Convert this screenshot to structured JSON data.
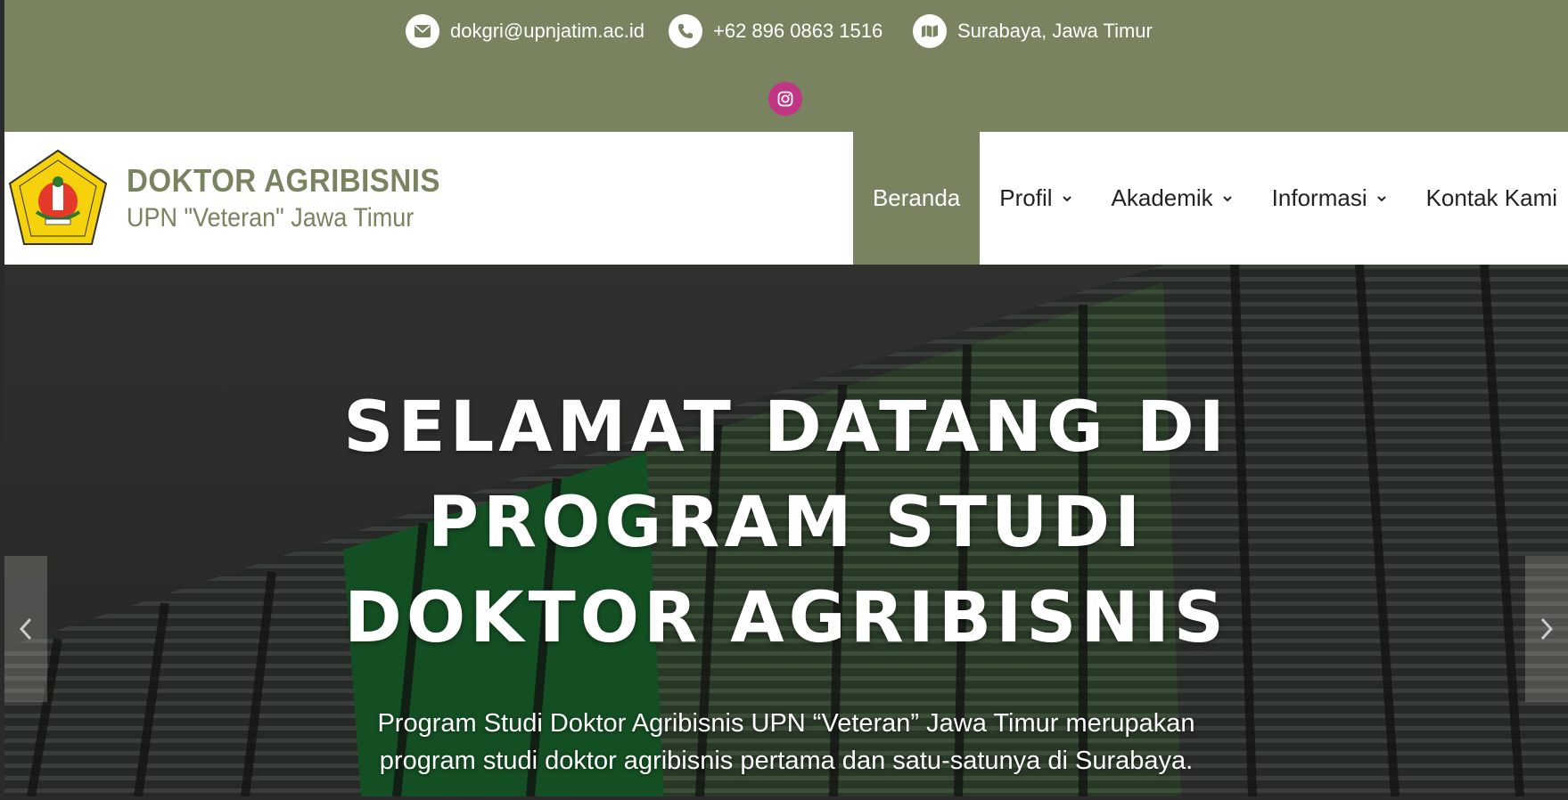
{
  "topbar": {
    "email": "dokgri@upnjatim.ac.id",
    "phone": "+62 896 0863 1516",
    "location": "Surabaya, Jawa Timur",
    "email_icon": "envelope-icon",
    "phone_icon": "phone-icon",
    "location_icon": "map-icon",
    "social_icon": "instagram-icon"
  },
  "header": {
    "brand_title": "DOKTOR AGRIBISNIS",
    "brand_subtitle": "UPN \"Veteran\" Jawa Timur",
    "logo_icon": "upn-veteran-emblem"
  },
  "nav": {
    "items": [
      {
        "label": "Beranda",
        "active": true
      },
      {
        "label": "Profil",
        "has_dropdown": true
      },
      {
        "label": "Akademik",
        "has_dropdown": true
      },
      {
        "label": "Informasi",
        "has_dropdown": true
      },
      {
        "label": "Kontak Kami"
      }
    ]
  },
  "hero": {
    "title_line1": "SELAMAT DATANG DI",
    "title_line2": "PROGRAM STUDI",
    "title_line3": "DOKTOR AGRIBISNIS",
    "desc_line1": "Program Studi Doktor Agribisnis UPN “Veteran” Jawa Timur merupakan",
    "desc_line2": "program studi doktor agribisnis pertama dan satu-satunya di Surabaya."
  },
  "colors": {
    "accent": "#7a835f",
    "instagram": "#c13584"
  }
}
